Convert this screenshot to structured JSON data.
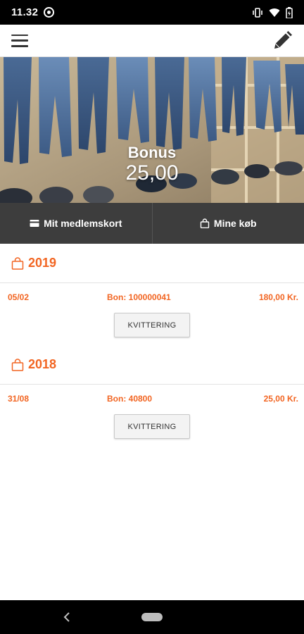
{
  "status_bar": {
    "time": "11.32",
    "icons": [
      "app-notification-icon",
      "vibrate-icon",
      "wifi-icon",
      "battery-icon"
    ]
  },
  "app_bar": {
    "menu_icon": "hamburger-menu-icon",
    "edit_icon": "pencil-edit-icon"
  },
  "hero": {
    "bonus_label": "Bonus",
    "bonus_value": "25,00"
  },
  "tabs": [
    {
      "label": "Mit medlemskort",
      "icon": "card-icon"
    },
    {
      "label": "Mine køb",
      "icon": "shopping-bag-icon"
    }
  ],
  "purchase_groups": [
    {
      "year": "2019",
      "items": [
        {
          "date": "05/02",
          "bon": "Bon: 100000041",
          "amount": "180,00 Kr.",
          "button": "KVITTERING"
        }
      ]
    },
    {
      "year": "2018",
      "items": [
        {
          "date": "31/08",
          "bon": "Bon: 40800",
          "amount": "25,00 Kr.",
          "button": "KVITTERING"
        }
      ]
    }
  ],
  "colors": {
    "accent": "#f26522",
    "tab_bar": "#3d3d3d",
    "status_bar": "#000000"
  }
}
